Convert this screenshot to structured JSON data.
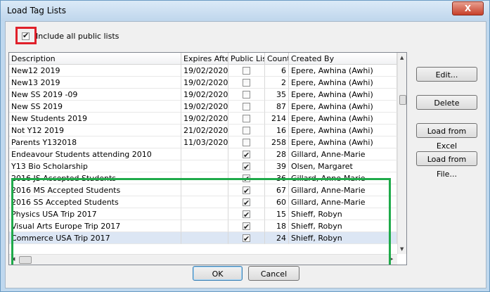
{
  "window": {
    "title": "Load Tag Lists",
    "close_glyph": "X"
  },
  "public_lists": {
    "label": "Include all public lists",
    "checked": true
  },
  "columns": [
    "Description",
    "Expires After",
    "Public List",
    "Count",
    "Created By"
  ],
  "rows": [
    {
      "description": "New12 2019",
      "expires": "19/02/2020",
      "public": false,
      "count": "6",
      "created_by": "Epere, Awhina (Awhi)"
    },
    {
      "description": "New13 2019",
      "expires": "19/02/2020",
      "public": false,
      "count": "2",
      "created_by": "Epere, Awhina (Awhi)"
    },
    {
      "description": "New SS 2019 -09",
      "expires": "19/02/2020",
      "public": false,
      "count": "35",
      "created_by": "Epere, Awhina (Awhi)"
    },
    {
      "description": "New SS 2019",
      "expires": "19/02/2020",
      "public": false,
      "count": "87",
      "created_by": "Epere, Awhina (Awhi)"
    },
    {
      "description": "New Students 2019",
      "expires": "19/02/2020",
      "public": false,
      "count": "214",
      "created_by": "Epere, Awhina (Awhi)"
    },
    {
      "description": "Not Y12 2019",
      "expires": "21/02/2020",
      "public": false,
      "count": "16",
      "created_by": "Epere, Awhina (Awhi)"
    },
    {
      "description": "Parents Y132018",
      "expires": "11/03/2020",
      "public": false,
      "count": "258",
      "created_by": "Epere, Awhina (Awhi)"
    },
    {
      "description": "Endeavour Students attending 2010",
      "expires": "",
      "public": true,
      "count": "28",
      "created_by": "Gillard, Anne-Marie"
    },
    {
      "description": "Y13 Bio Scholarship",
      "expires": "",
      "public": true,
      "count": "39",
      "created_by": "Olsen, Margaret"
    },
    {
      "description": "2016 JS Accepted Students",
      "expires": "",
      "public": true,
      "count": "36",
      "created_by": "Gillard, Anne-Marie"
    },
    {
      "description": "2016 MS Accepted Students",
      "expires": "",
      "public": true,
      "count": "67",
      "created_by": "Gillard, Anne-Marie"
    },
    {
      "description": "2016 SS Accepted Students",
      "expires": "",
      "public": true,
      "count": "60",
      "created_by": "Gillard, Anne-Marie"
    },
    {
      "description": "Physics USA Trip 2017",
      "expires": "",
      "public": true,
      "count": "15",
      "created_by": "Shieff, Robyn"
    },
    {
      "description": "Visual Arts Europe Trip 2017",
      "expires": "",
      "public": true,
      "count": "18",
      "created_by": "Shieff, Robyn"
    },
    {
      "description": "Commerce USA Trip 2017",
      "expires": "",
      "public": true,
      "count": "24",
      "created_by": "Shieff, Robyn",
      "selected": true
    }
  ],
  "side_buttons": {
    "edit": "Edit...",
    "delete": "Delete",
    "load_excel": "Load from Excel",
    "load_file": "Load from File..."
  },
  "footer": {
    "ok": "OK",
    "cancel": "Cancel"
  },
  "colors": {
    "highlight_red": "#e0202a",
    "highlight_green": "#1faa4a",
    "selected_row": "#dce6f4"
  }
}
